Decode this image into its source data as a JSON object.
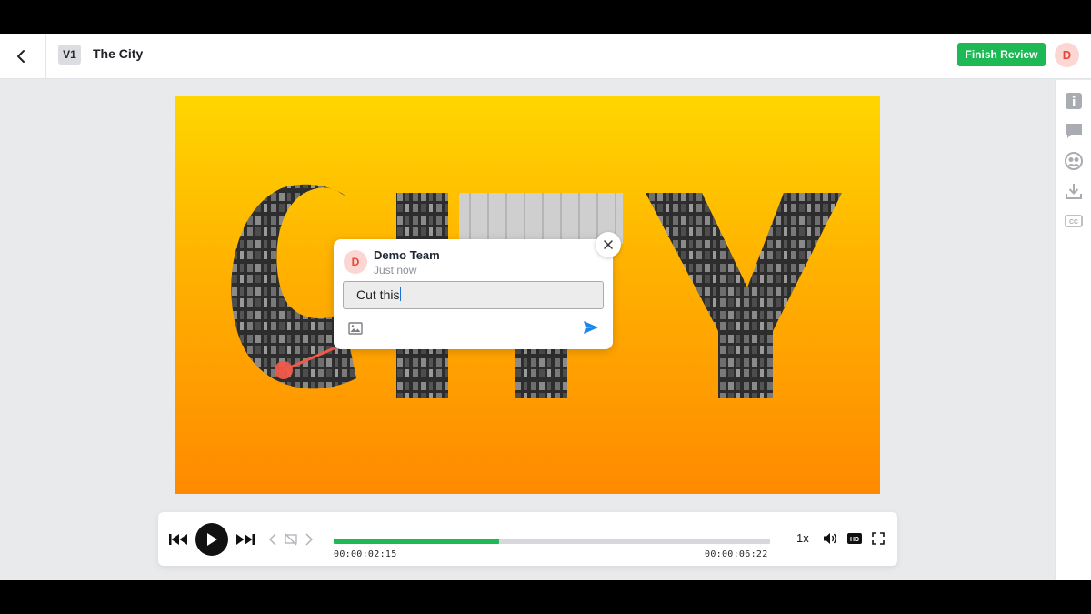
{
  "header": {
    "back_icon": "chevron-left-icon",
    "version": "V1",
    "title": "The City",
    "finish_label": "Finish Review",
    "user_initial": "D"
  },
  "right_rail": {
    "icons": [
      "info-icon",
      "comment-icon",
      "group-icon",
      "download-icon",
      "cc-icon"
    ],
    "cc_label": "CC"
  },
  "video": {
    "artwork_text": "CITY",
    "annotation_color": "#f05a4a"
  },
  "comment": {
    "author_initial": "D",
    "author": "Demo Team",
    "time": "Just now",
    "input_value": "Cut this",
    "attach_icon": "image-icon",
    "send_icon": "send-icon",
    "close_icon": "close-icon"
  },
  "player": {
    "current_time": "00:00:02:15",
    "duration": "00:00:06:22",
    "progress_fraction": 0.379,
    "speed": "1x",
    "hd_label": "HD",
    "accent": "#1db954"
  }
}
